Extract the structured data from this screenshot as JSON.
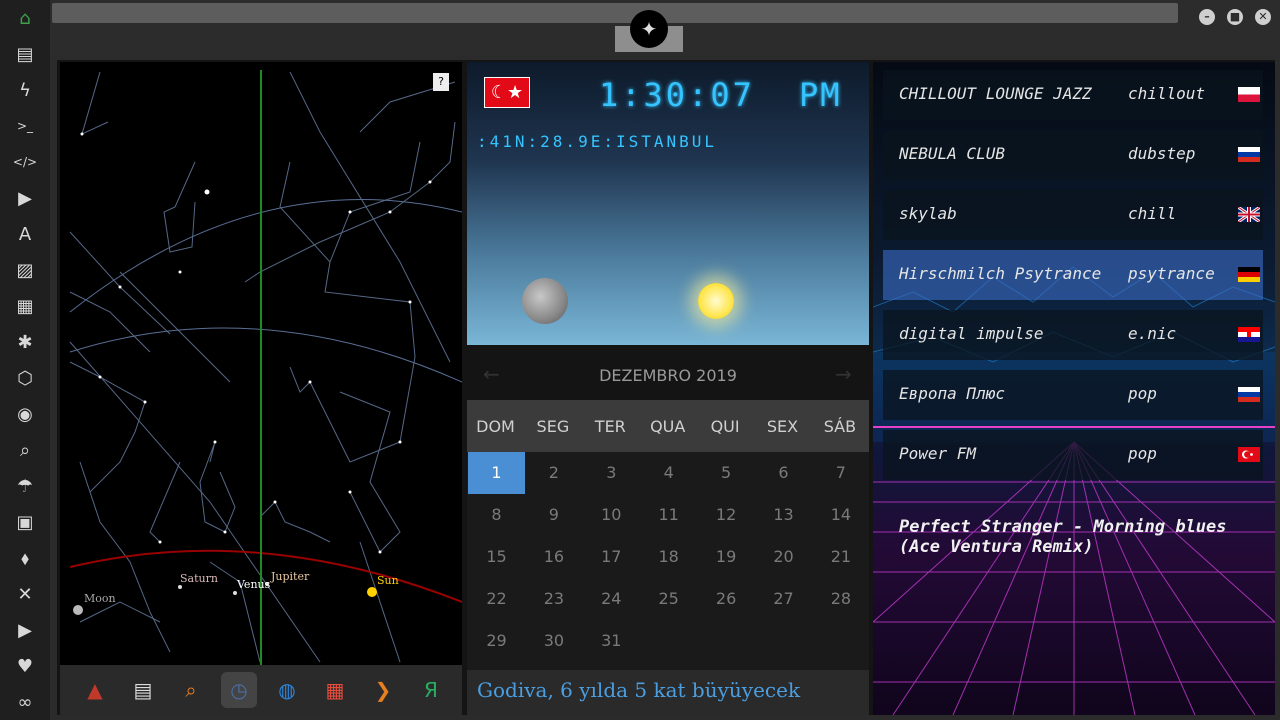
{
  "sidebar": {
    "items": [
      {
        "icon": "home-icon",
        "glyph": "⌂"
      },
      {
        "icon": "document-icon",
        "glyph": "▤"
      },
      {
        "icon": "lightning-icon",
        "glyph": "ϟ"
      },
      {
        "icon": "terminal-icon",
        "glyph": ">_"
      },
      {
        "icon": "code-icon",
        "glyph": "</>"
      },
      {
        "icon": "play-icon",
        "glyph": "▶"
      },
      {
        "icon": "translate-icon",
        "glyph": "A"
      },
      {
        "icon": "image-icon",
        "glyph": "▨"
      },
      {
        "icon": "news-icon",
        "glyph": "▦"
      },
      {
        "icon": "asterisk-icon",
        "glyph": "✱"
      },
      {
        "icon": "hexagon-icon",
        "glyph": "⬡"
      },
      {
        "icon": "globe-icon",
        "glyph": "◉"
      },
      {
        "icon": "search-icon",
        "glyph": "⌕"
      },
      {
        "icon": "umbrella-icon",
        "glyph": "☂"
      },
      {
        "icon": "contact-icon",
        "glyph": "▣"
      },
      {
        "icon": "link-icon",
        "glyph": "⬧"
      },
      {
        "icon": "expand-icon",
        "glyph": "✕"
      },
      {
        "icon": "youtube-icon",
        "glyph": "▶"
      },
      {
        "icon": "heart-icon",
        "glyph": "♥"
      },
      {
        "icon": "infinity-icon",
        "glyph": "∞"
      }
    ]
  },
  "sky": {
    "help_label": "?",
    "labels": {
      "moon": "Moon",
      "saturn": "Saturn",
      "venus": "Venus",
      "jupiter": "Jupiter",
      "sun": "Sun"
    }
  },
  "taskbar": {
    "apps": [
      {
        "icon": "astronomy-app-icon",
        "glyph": "▲",
        "color": "#c0392b"
      },
      {
        "icon": "news-app-icon",
        "glyph": "▤",
        "color": "#dddddd"
      },
      {
        "icon": "search-app-icon",
        "glyph": "⌕",
        "color": "#e67e22"
      },
      {
        "icon": "clock-app-icon",
        "glyph": "◷",
        "color": "#4a6fa5"
      },
      {
        "icon": "globe-app-icon",
        "glyph": "◍",
        "color": "#2e86de"
      },
      {
        "icon": "calendar-app-icon",
        "glyph": "▦",
        "color": "#e74c3c"
      },
      {
        "icon": "forward-app-icon",
        "glyph": "❯",
        "color": "#e67e22"
      },
      {
        "icon": "yandex-app-icon",
        "glyph": "Я",
        "color": "#27ae60"
      }
    ]
  },
  "clock": {
    "time": "1:30:07",
    "ampm": "PM",
    "location": ":41N:28.9E:ISTANBUL"
  },
  "calendar": {
    "month_label": "DEZEMBRO 2019",
    "prev": "←",
    "next": "→",
    "day_names": [
      "DOM",
      "SEG",
      "TER",
      "QUA",
      "QUI",
      "SEX",
      "SÁB"
    ],
    "weeks": [
      [
        "1",
        "2",
        "3",
        "4",
        "5",
        "6",
        "7"
      ],
      [
        "8",
        "9",
        "10",
        "11",
        "12",
        "13",
        "14"
      ],
      [
        "15",
        "16",
        "17",
        "18",
        "19",
        "20",
        "21"
      ],
      [
        "22",
        "23",
        "24",
        "25",
        "26",
        "27",
        "28"
      ],
      [
        "29",
        "30",
        "31",
        "",
        "",
        "",
        ""
      ]
    ],
    "today": "1"
  },
  "news": {
    "headline": "Godiva, 6 yılda 5 kat büyüyecek"
  },
  "radio": {
    "stations": [
      {
        "name": "CHILLOUT LOUNGE JAZZ",
        "genre": "chillout",
        "flag": "pl"
      },
      {
        "name": "NEBULA CLUB",
        "genre": "dubstep",
        "flag": "ru"
      },
      {
        "name": "skylab",
        "genre": "chill",
        "flag": "gb"
      },
      {
        "name": "Hirschmilch Psytrance",
        "genre": "psytrance",
        "flag": "de"
      },
      {
        "name": "digital impulse",
        "genre": "e.nic",
        "flag": "hr"
      },
      {
        "name": "Европа Плюс",
        "genre": "pop",
        "flag": "ru"
      },
      {
        "name": "Power FM",
        "genre": "pop",
        "flag": "tr"
      }
    ],
    "active_index": 3,
    "now_playing": "Perfect Stranger - Morning blues (Ace Ventura Remix)"
  },
  "colors": {
    "accent": "#35c4ff",
    "active_station": "#3c6ec8",
    "today": "#4a8fd4",
    "home": "#3fa04c"
  }
}
